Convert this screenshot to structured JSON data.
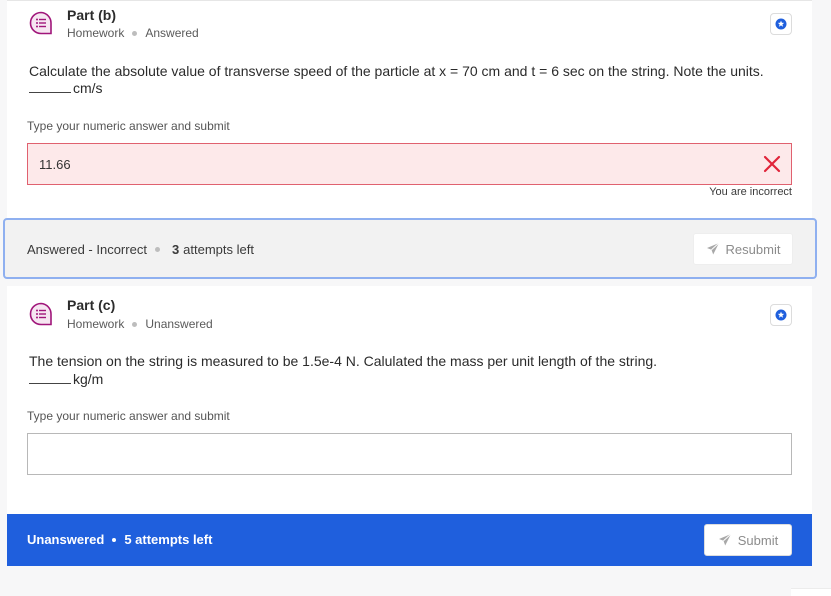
{
  "colors": {
    "accent": "#1f5fdd",
    "focus_outline": "#8fb0f0",
    "incorrect_bg": "#fde9ea",
    "incorrect_border": "#e0616f",
    "incorrect_icon": "#e0243a",
    "part_icon": "#a0157a"
  },
  "part_b": {
    "icon": "discussion-list-icon",
    "title": "Part (b)",
    "category": "Homework",
    "state": "Answered",
    "question": "Calculate the absolute value of transverse speed of the particle at x = 70 cm and t = 6 sec on the string. Note the units.",
    "unit": "cm/s",
    "instruction": "Type your numeric answer and submit",
    "answer_value": "11.66",
    "feedback": "You are incorrect",
    "status_label": "Answered - Incorrect",
    "attempts_count": "3",
    "attempts_suffix": "attempts left",
    "button_label": "Resubmit"
  },
  "part_c": {
    "icon": "discussion-list-icon",
    "title": "Part (c)",
    "category": "Homework",
    "state": "Unanswered",
    "question": "The tension on the string is measured to be 1.5e-4 N. Calulated the mass per unit length of the string.",
    "unit": "kg/m",
    "instruction": "Type your numeric answer and submit",
    "answer_value": "",
    "status_label": "Unanswered",
    "attempts_text": "5 attempts left",
    "button_label": "Submit"
  }
}
